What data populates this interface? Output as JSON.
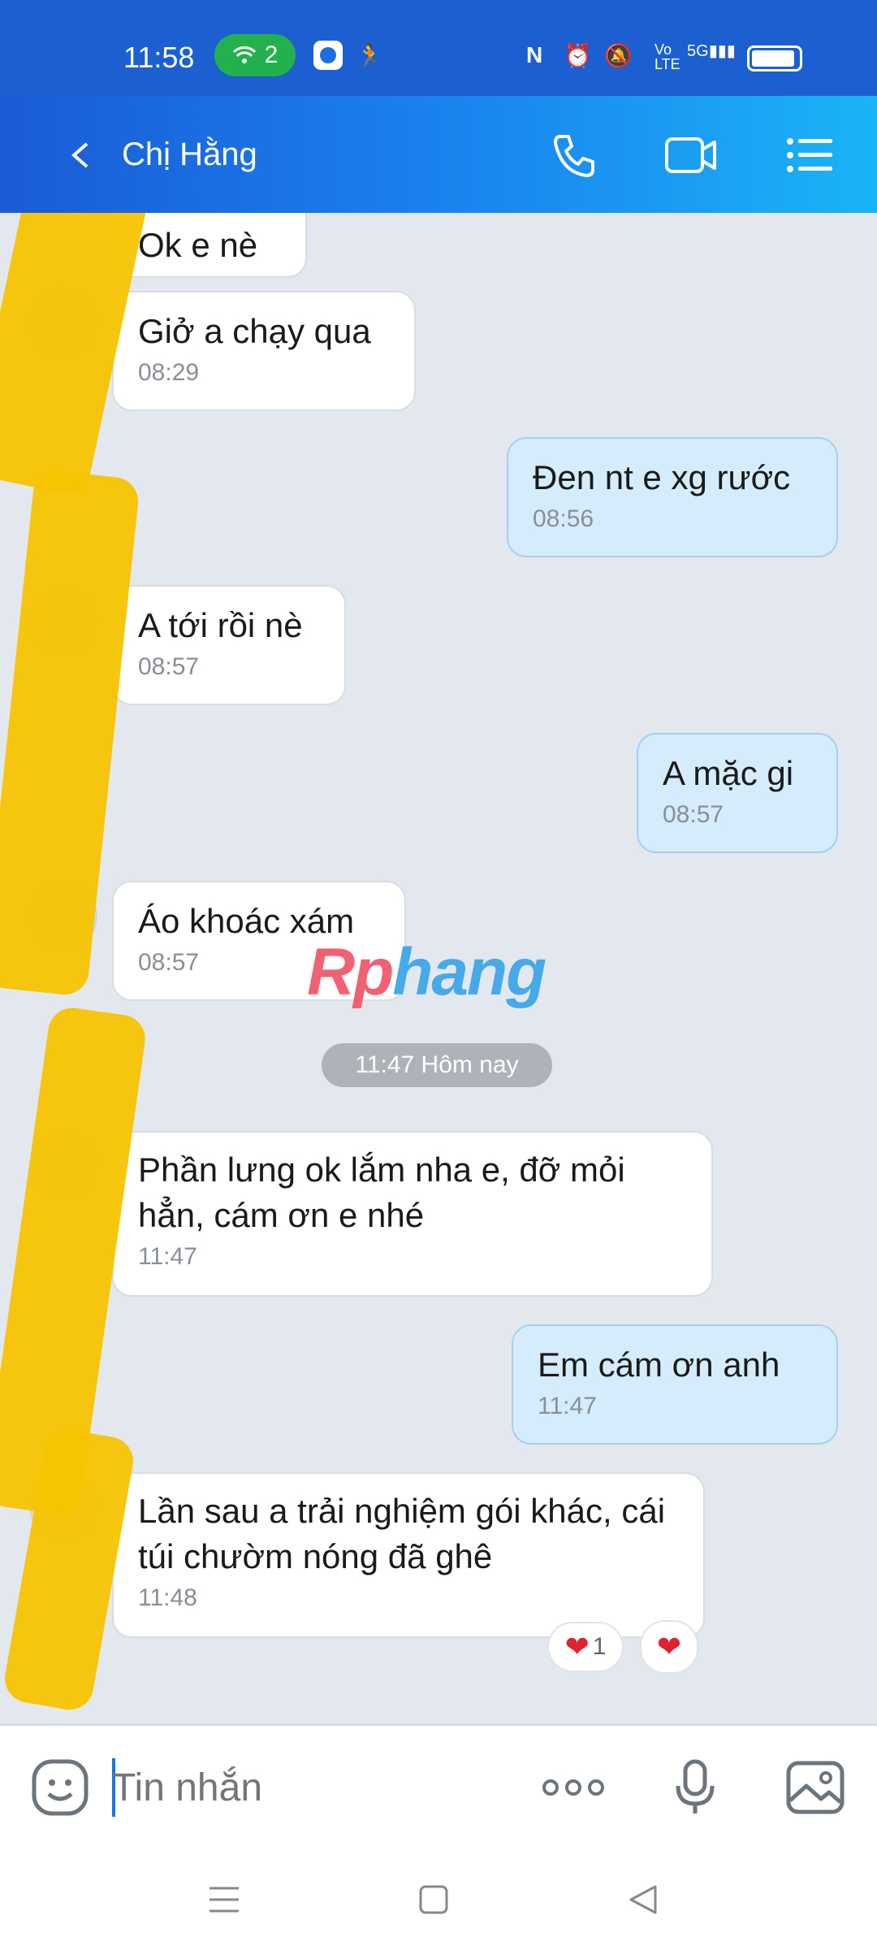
{
  "status_bar": {
    "time": "11:58",
    "pill_count": "2",
    "signal_label": "5G"
  },
  "header": {
    "contact_name": "Chị Hằng"
  },
  "messages": [
    {
      "dir": "in",
      "text": "Ok e nè",
      "time": ""
    },
    {
      "dir": "in",
      "text": "Giở a chạy qua",
      "time": "08:29"
    },
    {
      "dir": "out",
      "text": "Đen nt e xg rước",
      "time": "08:56"
    },
    {
      "dir": "in",
      "text": "A tới rồi nè",
      "time": "08:57"
    },
    {
      "dir": "out",
      "text": "A mặc gi",
      "time": "08:57"
    },
    {
      "dir": "in",
      "text": "Áo khoác xám",
      "time": "08:57"
    },
    {
      "dir": "in",
      "text": "Phần lưng ok lắm nha e, đỡ mỏi hẳn, cám ơn e nhé",
      "time": "11:47"
    },
    {
      "dir": "out",
      "text": "Em cám ơn anh",
      "time": "11:47"
    },
    {
      "dir": "in",
      "text": "Lần sau a trải nghiệm gói khác, cái túi chườm nóng đã ghê",
      "time": "11:48"
    }
  ],
  "date_divider": "11:47 Hôm nay",
  "reactions": {
    "count": "1"
  },
  "watermark": {
    "part1": "Rp",
    "part2": "hang"
  },
  "input": {
    "placeholder": "Tin nhắn"
  },
  "colors": {
    "header_gradient_start": "#1a5bd6",
    "header_gradient_end": "#1ab4f5",
    "incoming_bubble": "#ffffff",
    "outgoing_bubble": "#d5ecfd",
    "chat_background": "#e3e8ef",
    "heart": "#e0222e"
  },
  "icons": {
    "back": "back-arrow-icon",
    "call": "phone-icon",
    "video": "video-camera-icon",
    "menu": "list-menu-icon",
    "emoji": "emoji-icon",
    "more": "more-dots-icon",
    "mic": "microphone-icon",
    "gallery": "image-gallery-icon"
  }
}
